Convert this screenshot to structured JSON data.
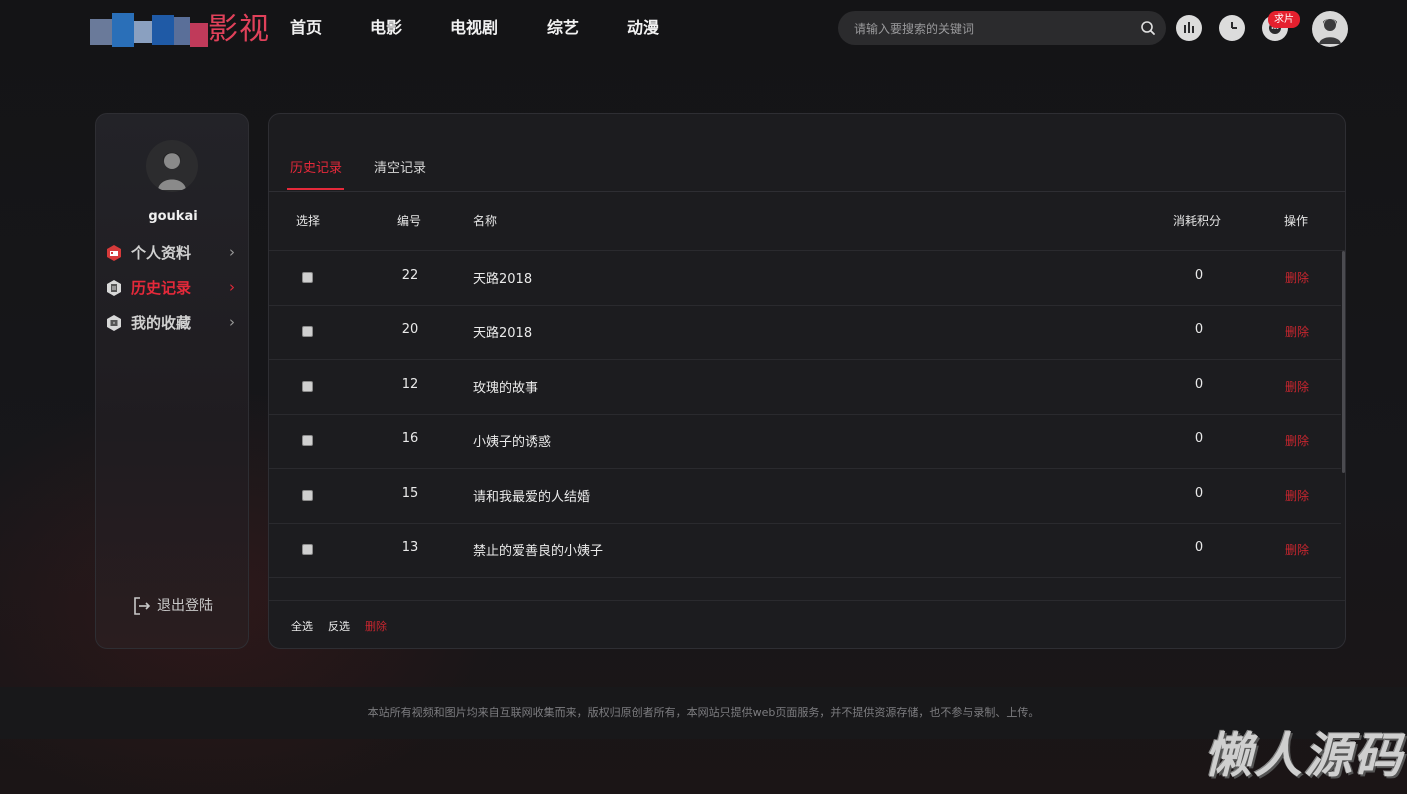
{
  "header": {
    "logo_text": "影视",
    "nav": [
      "首页",
      "电影",
      "电视剧",
      "综艺",
      "动漫"
    ],
    "search_placeholder": "请输入要搜索的关键词",
    "badge": "求片"
  },
  "sidebar": {
    "username": "goukai",
    "items": [
      {
        "label": "个人资料",
        "icon": "id-card-icon",
        "active": false
      },
      {
        "label": "历史记录",
        "icon": "history-doc-icon",
        "active": true
      },
      {
        "label": "我的收藏",
        "icon": "favorites-icon",
        "active": false
      }
    ],
    "logout_label": "退出登陆"
  },
  "main": {
    "tabs": [
      "历史记录",
      "清空记录"
    ],
    "columns": [
      "选择",
      "编号",
      "名称",
      "消耗积分",
      "操作"
    ],
    "rows": [
      {
        "id": "22",
        "name": "天路2018",
        "points": "0",
        "action": "删除"
      },
      {
        "id": "20",
        "name": "天路2018",
        "points": "0",
        "action": "删除"
      },
      {
        "id": "12",
        "name": "玫瑰的故事",
        "points": "0",
        "action": "删除"
      },
      {
        "id": "16",
        "name": "小姨子的诱惑",
        "points": "0",
        "action": "删除"
      },
      {
        "id": "15",
        "name": "请和我最爱的人结婚",
        "points": "0",
        "action": "删除"
      },
      {
        "id": "13",
        "name": "禁止的爱善良的小姨子",
        "points": "0",
        "action": "删除"
      }
    ],
    "footer": {
      "select_all": "全选",
      "invert": "反选",
      "delete": "删除"
    }
  },
  "copyright": "本站所有视频和图片均来自互联网收集而来，版权归原创者所有，本网站只提供web页面服务，并不提供资源存储，也不参与录制、上传。",
  "watermark": "懒人源码",
  "colors": {
    "accent": "#e5293a",
    "background": "#141416",
    "panel": "#1c1c1f"
  }
}
